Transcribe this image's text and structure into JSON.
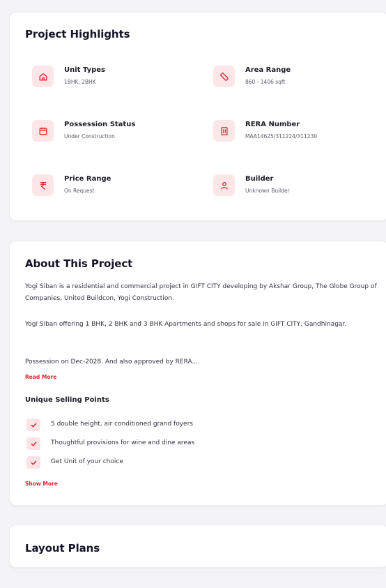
{
  "highlights": {
    "title": "Project Highlights",
    "items": [
      {
        "label": "Unit Types",
        "value": "1BHK, 2BHK",
        "icon": "home-icon"
      },
      {
        "label": "Area Range",
        "value": "860 - 1406 sqft",
        "icon": "ruler-icon"
      },
      {
        "label": "Possession Status",
        "value": "Under Construction",
        "icon": "calendar-icon"
      },
      {
        "label": "RERA Number",
        "value": "MAA14625/311224/311230",
        "icon": "building-icon"
      },
      {
        "label": "Price Range",
        "value": "On Request",
        "icon": "rupee-icon"
      },
      {
        "label": "Builder",
        "value": "Unknown Builder",
        "icon": "person-icon"
      }
    ]
  },
  "about": {
    "title": "About This Project",
    "paragraph1": "Yogi Siban is a residential and commercial project in GIFT CITY developing by Akshar Group, The Globe Group of Companies, United Buildcon, Yogi Construction.",
    "paragraph2": "Yogi Siban offering 1 BHK, 2 BHK and 3 BHK Apartments and shops for sale in GIFT CITY, Gandhinagar.",
    "paragraph3": "Possession on Dec-2028. And also approved by RERA....",
    "read_more": "Read More",
    "usp_title": "Unique Selling Points",
    "usps": [
      "5 double height, air conditioned grand foyers",
      "Thoughtful provisions for wine and dine areas",
      "Get Unit of your choice"
    ],
    "show_more": "Show More"
  },
  "layout": {
    "title": "Layout Plans"
  },
  "colors": {
    "accent": "#e0242c",
    "icon_bg": "#fde6e8",
    "page_bg": "#f4f4f6"
  }
}
